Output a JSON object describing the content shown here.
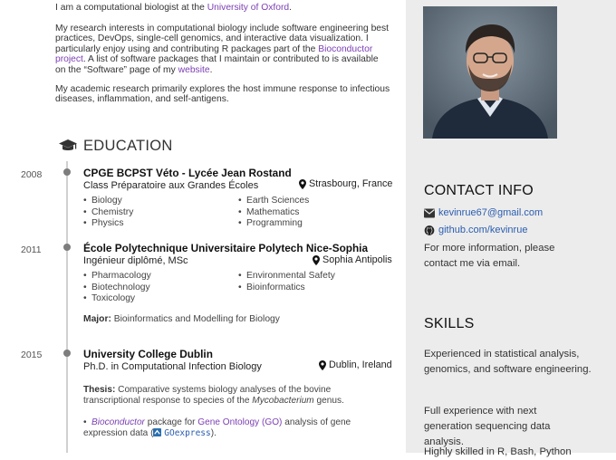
{
  "about": {
    "p1_prefix": "I am a computational biologist at the ",
    "p1_link": "University of Oxford",
    "p1_suffix": ".",
    "p2_a": "My research interests in computational biology include software engineering best practices, DevOps, single-cell genomics, and interactive data visualization. I particularly enjoy using and contributing R packages part of the ",
    "p2_link1": "Bioconductor project",
    "p2_b": ". A list of software packages that I maintain or contributed to is available on the “Software” page of my ",
    "p2_link2": "website",
    "p2_c": ".",
    "p3": "My academic research primarily explores the host immune response to infectious diseases, inflammation, and self-antigens."
  },
  "education": {
    "heading": "EDUCATION",
    "icon": "graduation-cap-icon",
    "entries": [
      {
        "year": "2008",
        "title": "CPGE BCPST Véto - Lycée Jean Rostand",
        "subtitle": "Class Préparatoire aux Grandes Écoles",
        "location": "Strasbourg, France",
        "courses": [
          "Biology",
          "Earth Sciences",
          "Chemistry",
          "Mathematics",
          "Physics",
          "Programming"
        ]
      },
      {
        "year": "2011",
        "title": "École Polytechnique Universitaire Polytech Nice-Sophia",
        "subtitle": "Ingénieur diplômé, MSc",
        "location": "Sophia Antipolis",
        "courses": [
          "Pharmacology",
          "Environmental Safety",
          "Biotechnology",
          "Bioinformatics",
          "Toxicology"
        ],
        "major_label": "Major:",
        "major": "Bioinformatics and Modelling for Biology"
      },
      {
        "year": "2015",
        "title": "University College Dublin",
        "subtitle": "Ph.D. in Computational Infection Biology",
        "location": "Dublin, Ireland",
        "thesis_label": "Thesis:",
        "thesis_a": "Comparative systems biology analyses of the bovine transcriptional response to species of the ",
        "thesis_italic": "Mycobacterium",
        "thesis_b": " genus.",
        "pkg_link1": "Bioconductor",
        "pkg_text1": " package for ",
        "pkg_link2": "Gene Ontology (GO)",
        "pkg_text2": " analysis of gene expression data (",
        "pkg_code": "GOexpress",
        "pkg_text3": ")."
      }
    ]
  },
  "sidebar": {
    "contact_heading": "CONTACT INFO",
    "email": "kevinrue67@gmail.com",
    "github": "github.com/kevinrue",
    "contact_note": "For more information, please contact me via email.",
    "skills_heading": "SKILLS",
    "skills": [
      "Experienced in statistical analysis, genomics, and software engineering.",
      "Full experience with next generation sequencing data analysis.",
      "Highly skilled in R, Bash, Python"
    ]
  }
}
